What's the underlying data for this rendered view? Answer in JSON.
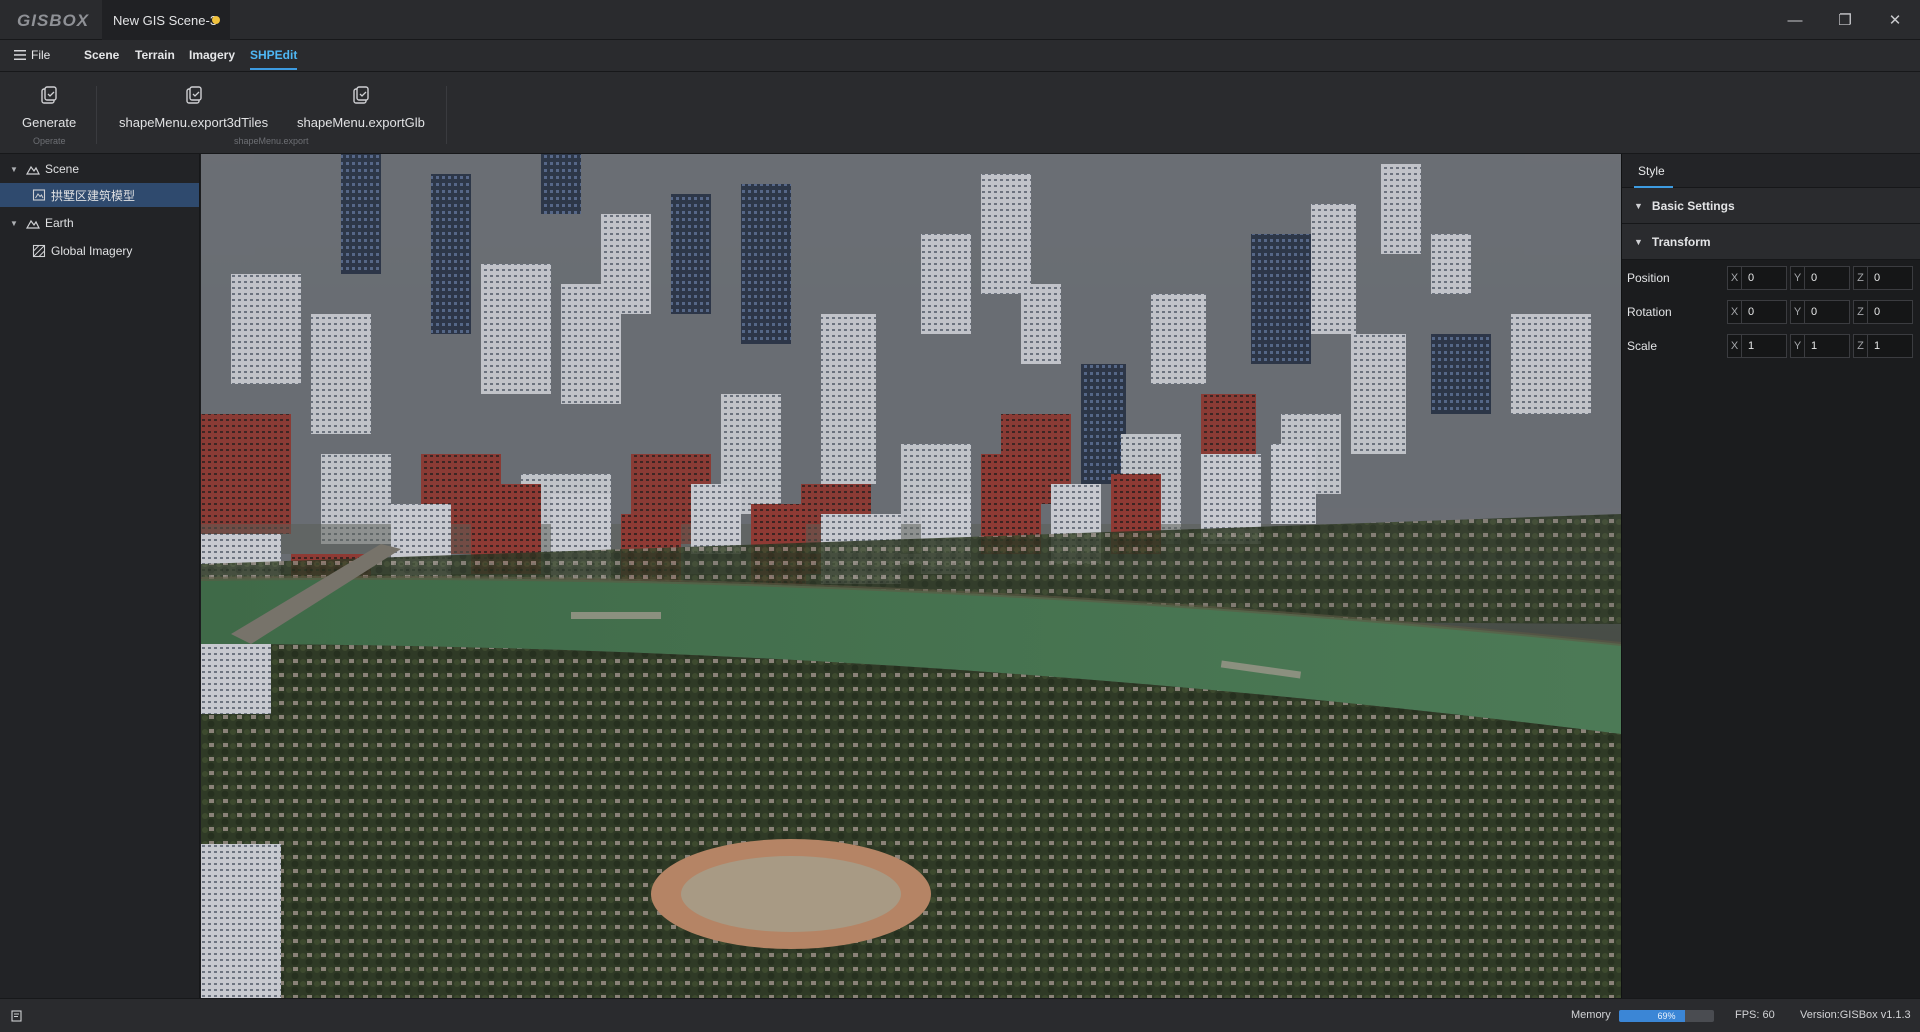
{
  "app": {
    "logo": "GISBOX",
    "tab_title": "New GIS Scene-3"
  },
  "window_controls": {
    "minimize": "—",
    "restore": "❐",
    "close": "✕"
  },
  "menu": {
    "file_label": "File",
    "items": [
      "Scene",
      "Terrain",
      "Imagery",
      "SHPEdit"
    ],
    "active": "SHPEdit"
  },
  "ribbon": {
    "generate_label": "Generate",
    "operate_group": "Operate",
    "export3dtiles_label": "shapeMenu.export3dTiles",
    "exportglb_label": "shapeMenu.exportGlb",
    "export_group": "shapeMenu.export"
  },
  "tree": [
    {
      "label": "Scene",
      "icon": "scene-icon"
    },
    {
      "label": "拱墅区建筑模型",
      "icon": "model-icon"
    },
    {
      "label": "Earth",
      "icon": "earth-icon"
    },
    {
      "label": "Global Imagery",
      "icon": "imagery-icon"
    }
  ],
  "properties": {
    "tab": "Style",
    "basic_settings": "Basic Settings",
    "transform": "Transform",
    "rows": [
      {
        "label": "Position",
        "x": "0",
        "y": "0",
        "z": "0"
      },
      {
        "label": "Rotation",
        "x": "0",
        "y": "0",
        "z": "0"
      },
      {
        "label": "Scale",
        "x": "1",
        "y": "1",
        "z": "1"
      }
    ],
    "axes": {
      "x": "X",
      "y": "Y",
      "z": "Z"
    }
  },
  "status": {
    "memory_label": "Memory",
    "memory_percent": 69,
    "memory_text": "69%",
    "fps": "FPS: 60",
    "version": "Version:GISBox v1.1.3"
  },
  "colors": {
    "accent": "#3d9be0",
    "unsaved_dot": "#f0c23d",
    "selection": "#2f4a6e"
  }
}
